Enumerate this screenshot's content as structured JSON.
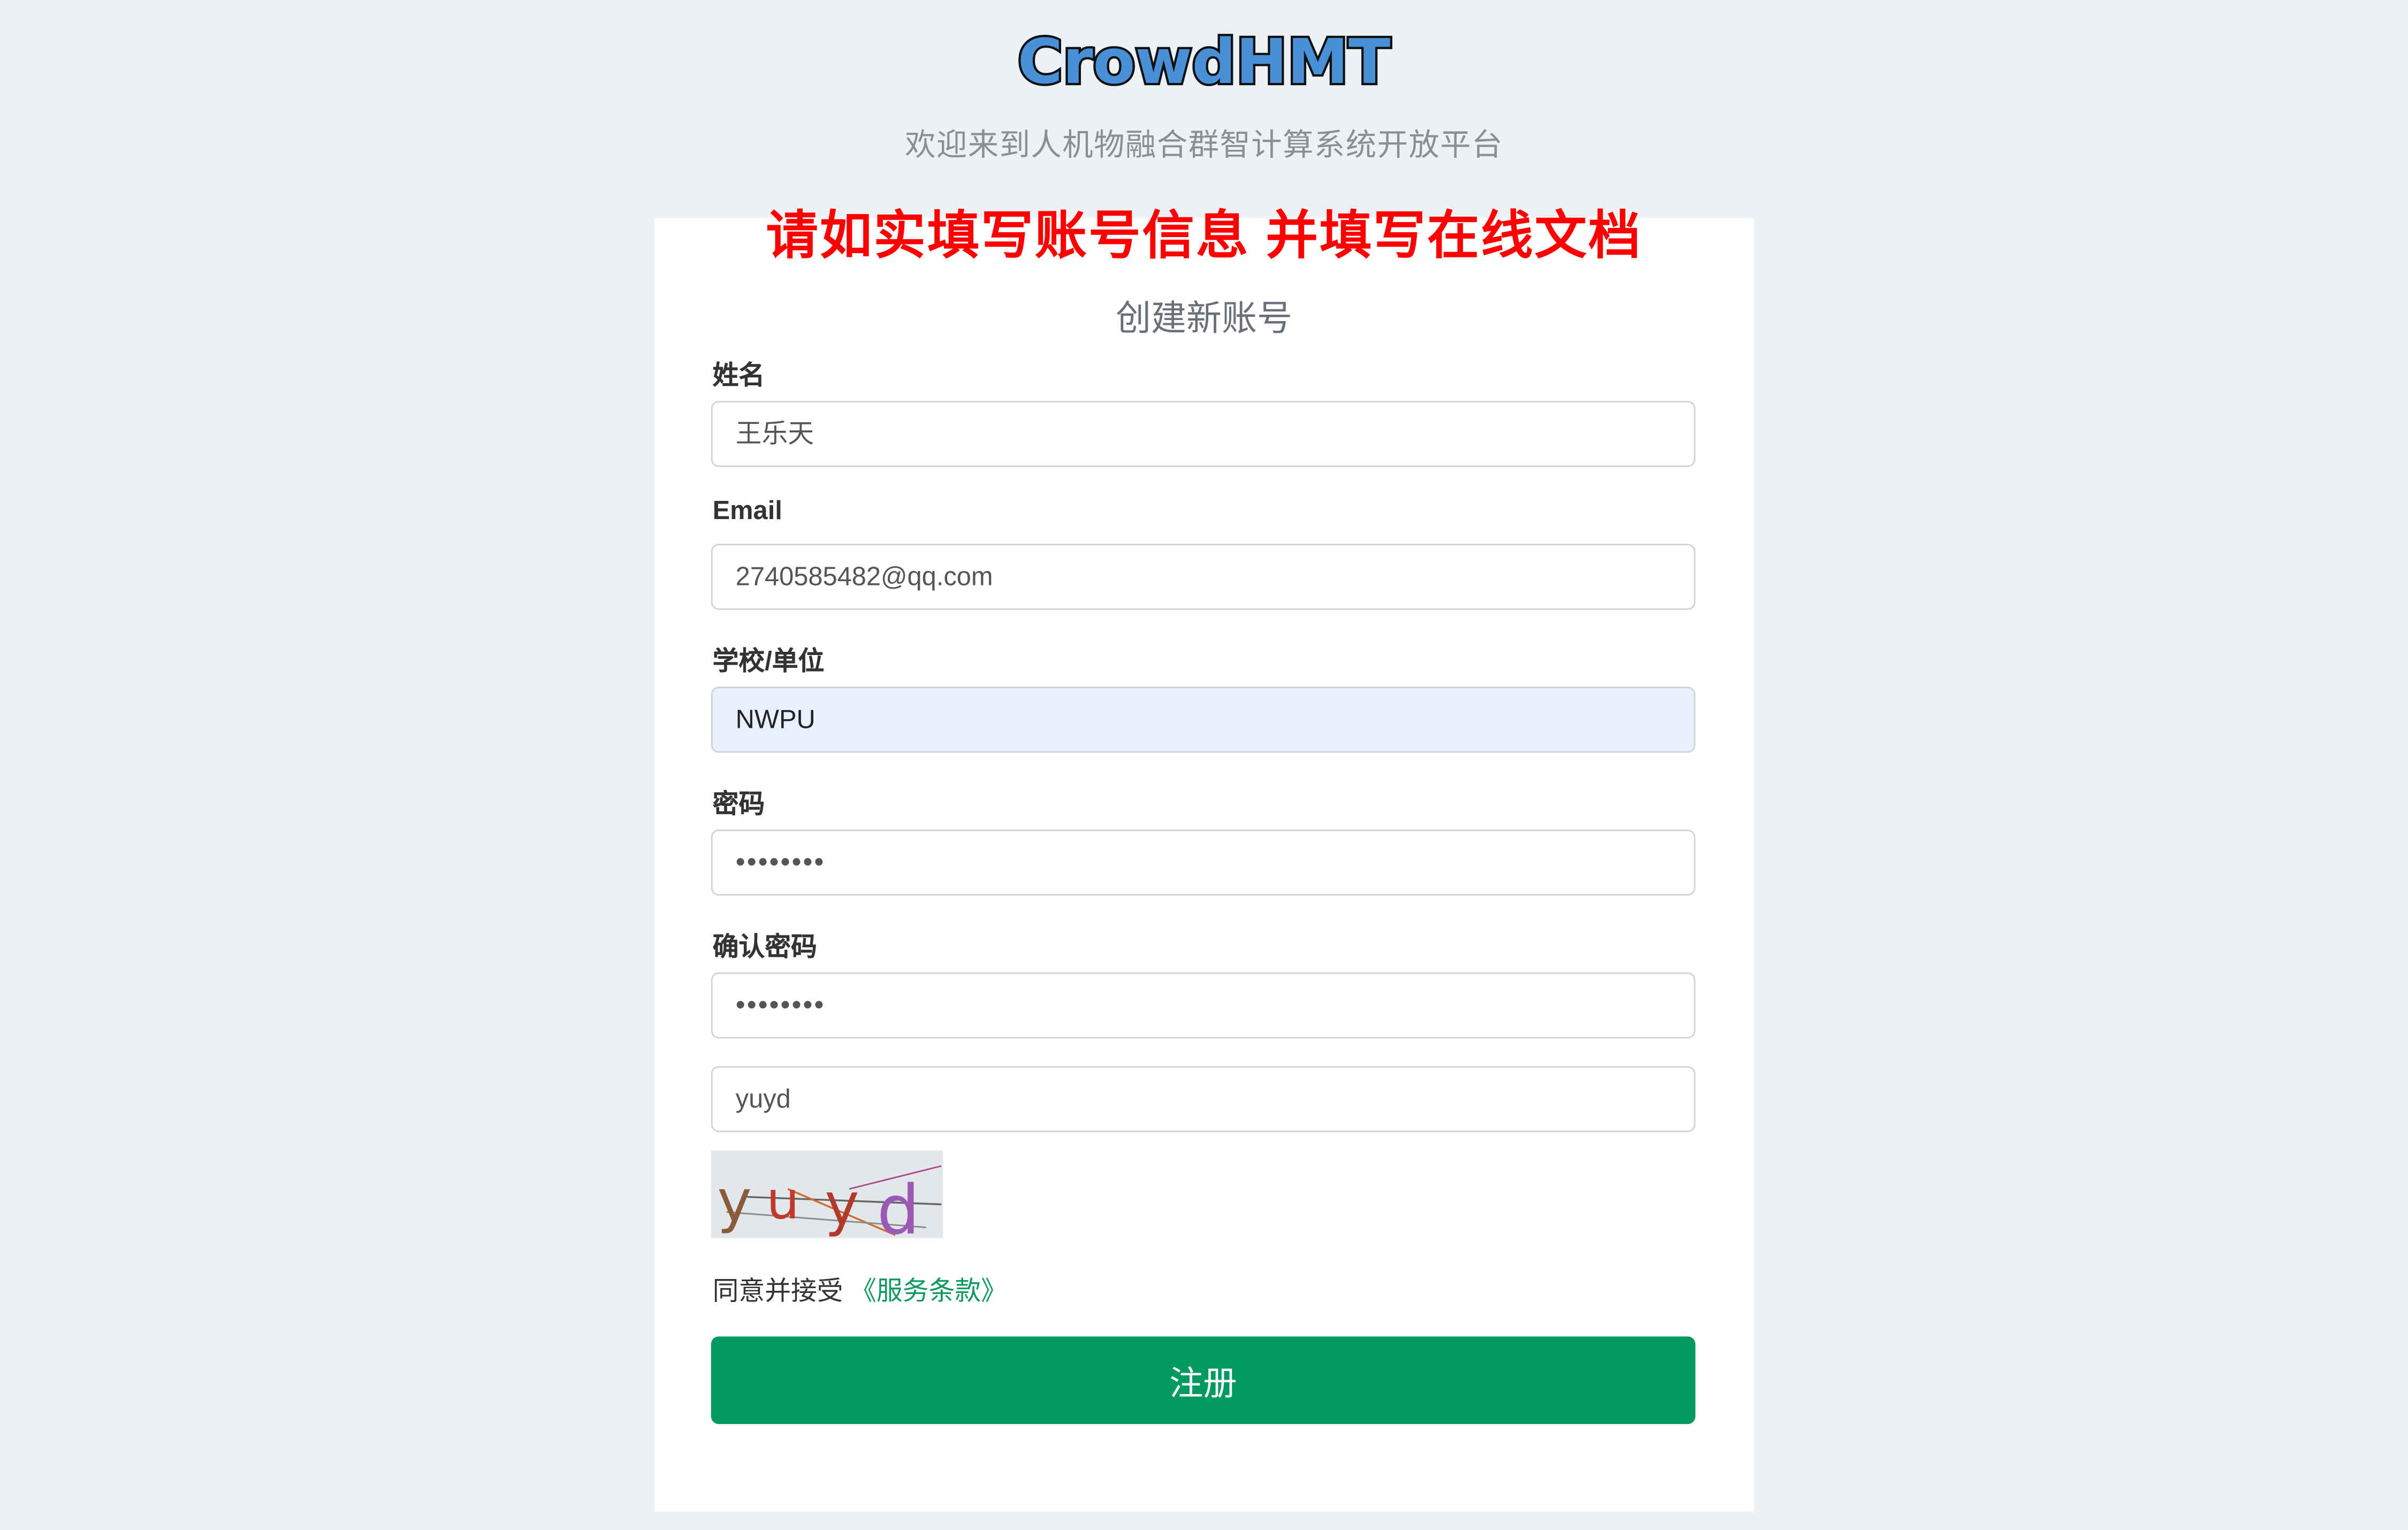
{
  "header": {
    "logo_text": "CrowdHMT",
    "subtitle": "欢迎来到人机物融合群智计算系统开放平台"
  },
  "notice": "请如实填写账号信息 并填写在线文档",
  "form": {
    "title": "创建新账号",
    "name": {
      "label": "姓名",
      "value": "王乐天"
    },
    "email": {
      "label": "Email",
      "value": "2740585482@qq.com"
    },
    "organization": {
      "label": "学校/单位",
      "value": "NWPU"
    },
    "password": {
      "label": "密码",
      "value": "••••••••"
    },
    "confirm_password": {
      "label": "确认密码",
      "value": "••••••••"
    },
    "captcha": {
      "value": "yuyd",
      "image_text": "yuyd"
    },
    "terms": {
      "prefix": "同意并接受",
      "link": "《服务条款》"
    },
    "submit_label": "注册"
  },
  "colors": {
    "background": "#eef1f4",
    "notice": "#ff0000",
    "primary": "#00995f",
    "link": "#0f9960",
    "logo_fill": "#4a90d9",
    "autofill": "#e8f0fe"
  }
}
